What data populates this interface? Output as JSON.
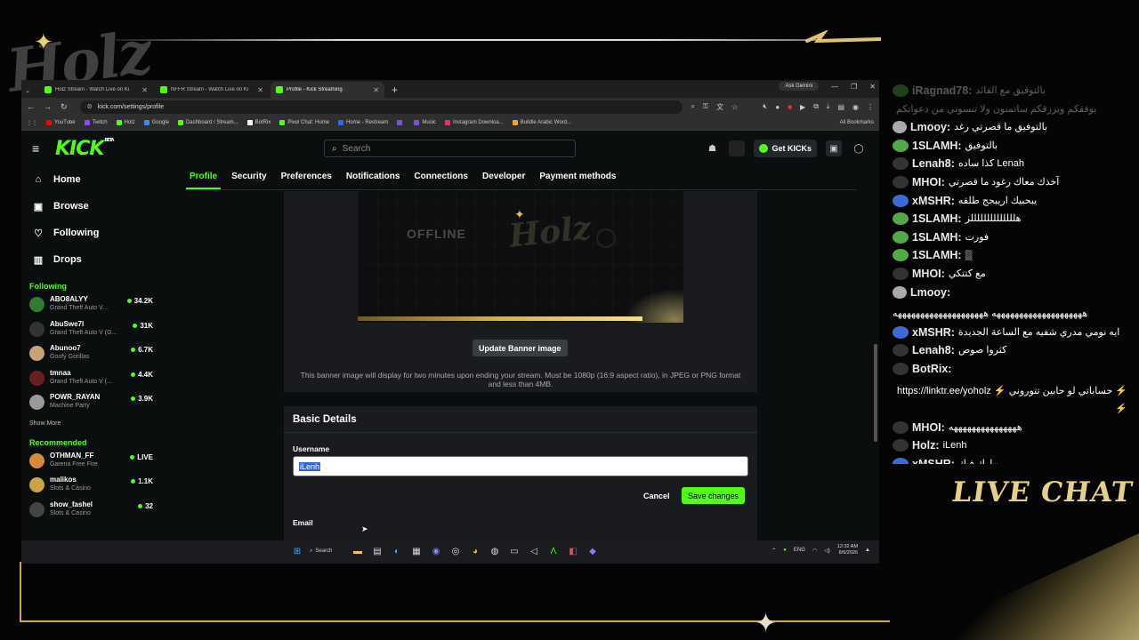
{
  "overlay": {
    "logo_text": "Holz",
    "live_chat_title": "LIVE CHAT"
  },
  "browser": {
    "tabs": [
      {
        "title": "Holz Stream - Watch Live on Ki",
        "favicon_color": "#53fc18",
        "active": false
      },
      {
        "title": "NFFR Stream - Watch Live on Ki",
        "favicon_color": "#53fc18",
        "active": false
      },
      {
        "title": "Profile - Kick Streaming",
        "favicon_color": "#53fc18",
        "active": true
      }
    ],
    "ask_gemini": "Ask Gemini",
    "url": "kick.com/settings/profile",
    "bookmarks": [
      {
        "label": "YouTube",
        "color": "#ff0000"
      },
      {
        "label": "Twitch",
        "color": "#9146ff"
      },
      {
        "label": "Holz",
        "color": "#53fc18"
      },
      {
        "label": "Google",
        "color": "#4285f4"
      },
      {
        "label": "Dashboard / Stream...",
        "color": "#53fc18"
      },
      {
        "label": "BotRix",
        "color": "#ffffff"
      },
      {
        "label": "Pixel Chat: Home",
        "color": "#53fc18"
      },
      {
        "label": "Home - Restream",
        "color": "#2c6af2"
      },
      {
        "label": "",
        "color": "#7b4fd6"
      },
      {
        "label": "Music",
        "color": "#7b4fd6"
      },
      {
        "label": "Instagram Downloa...",
        "color": "#e1306c"
      },
      {
        "label": "Buildle Arabic Word...",
        "color": "#f5a623"
      }
    ],
    "all_bookmarks": "All Bookmarks"
  },
  "kick": {
    "logo": "KICK",
    "logo_sup": "BETA",
    "search_placeholder": "Search",
    "get_kicks": "Get KICKs",
    "nav": [
      {
        "label": "Home",
        "icon": "home-icon",
        "glyph": "⌂"
      },
      {
        "label": "Browse",
        "icon": "browse-icon",
        "glyph": "▣"
      },
      {
        "label": "Following",
        "icon": "heart-icon",
        "glyph": "♡"
      },
      {
        "label": "Drops",
        "icon": "drops-icon",
        "glyph": "▥"
      }
    ],
    "following_title": "Following",
    "following": [
      {
        "name": "ABO8ALYY",
        "game": "Grand Theft Auto V...",
        "viewers": "34.2K",
        "color": "#2e7d32"
      },
      {
        "name": "AbuSwe7l",
        "game": "Grand Theft Auto V (G...",
        "viewers": "31K",
        "color": "#333"
      },
      {
        "name": "Abunoo7",
        "game": "Goofy Gorillas",
        "viewers": "6.7K",
        "color": "#c9a27a"
      },
      {
        "name": "tmnaa",
        "game": "Grand Theft Auto V (...",
        "viewers": "4.4K",
        "color": "#6b1e1e"
      },
      {
        "name": "POWR_RAYAN",
        "game": "Machine Party",
        "viewers": "3.9K",
        "color": "#999"
      }
    ],
    "show_more": "Show More",
    "recommended_title": "Recommended",
    "recommended": [
      {
        "name": "OTHMAN_FF",
        "game": "Garena Free Fire",
        "viewers": "LIVE",
        "color": "#d9893b"
      },
      {
        "name": "malikos",
        "game": "Slots & Casino",
        "viewers": "1.1K",
        "color": "#c9a545"
      },
      {
        "name": "show_fashel",
        "game": "Slots & Casino",
        "viewers": "32",
        "color": "#444"
      }
    ],
    "settings_tabs": [
      "Profile",
      "Security",
      "Preferences",
      "Notifications",
      "Connections",
      "Developer",
      "Payment methods"
    ],
    "banner": {
      "offline_label": "OFFLINE",
      "update_button": "Update Banner image",
      "note": "This banner image will display for two minutes upon ending your stream. Must be 1080p (16:9 aspect ratio), in JPEG or PNG format and less than 4MB."
    },
    "basic_details": {
      "title": "Basic Details",
      "username_label": "Username",
      "username_value": "iLenh",
      "cancel": "Cancel",
      "save": "Save changes",
      "email_label": "Email"
    }
  },
  "taskbar": {
    "search": "Search",
    "lang": "ENG",
    "time": "12:32 AM",
    "date": "8/6/2026"
  },
  "chat": [
    {
      "name": "iRagnad78:",
      "text": "بالتوفيق مع القائد",
      "badge": "green",
      "faded": true
    },
    {
      "name": "",
      "text": "يوفقكم ويرزقكم ساتمنون ولا تنسوني من دعواتكم",
      "badge": "",
      "faded": true
    },
    {
      "name": "Lmooy:",
      "text": "بالتوفيق ما قصرتي رغد",
      "badge": "gray",
      "faded": false
    },
    {
      "name": "1SLAMH:",
      "text": "بالتوفيق",
      "badge": "green",
      "faded": false
    },
    {
      "name": "Lenah8:",
      "text": "Lenah كذا ساده",
      "badge": "dark",
      "faded": false
    },
    {
      "name": "MHOI:",
      "text": "آخذك معاك رغود ما قصرتي",
      "badge": "dark",
      "faded": false
    },
    {
      "name": "xMSHR:",
      "text": "يبحبيك اريبجج طلقه",
      "badge": "blue",
      "faded": false
    },
    {
      "name": "1SLAMH:",
      "text": "هللللللللللللللز",
      "badge": "green",
      "faded": false
    },
    {
      "name": "1SLAMH:",
      "text": "فورت",
      "badge": "green",
      "faded": false
    },
    {
      "name": "1SLAMH:",
      "text": "▒",
      "badge": "green",
      "faded": false
    },
    {
      "name": "MHOI:",
      "text": "مع كتتكي",
      "badge": "dark",
      "faded": false
    },
    {
      "name": "Lmooy:",
      "text": "ههههههههههههههههههههه ههههههههههههههههههههه",
      "badge": "gray",
      "faded": false
    },
    {
      "name": "xMSHR:",
      "text": "ايه نومي مدري شفيه مع الساعة الجديدة",
      "badge": "blue",
      "faded": false
    },
    {
      "name": "Lenah8:",
      "text": "كثروا صوص",
      "badge": "dark",
      "faded": false
    },
    {
      "name": "BotRix:",
      "text": "⚡ حساباتي لو حابين تتوروني ⚡ https://linktr.ee/yoholz ⚡",
      "badge": "dark",
      "faded": false
    },
    {
      "name": "MHOI:",
      "text": "هههههههههههههههه",
      "badge": "dark",
      "faded": false
    },
    {
      "name": "Holz:",
      "text": "iLenh",
      "badge": "dark",
      "faded": false
    },
    {
      "name": "xMSHR:",
      "text": "يبارك فيك",
      "badge": "blue",
      "faded": false
    }
  ]
}
